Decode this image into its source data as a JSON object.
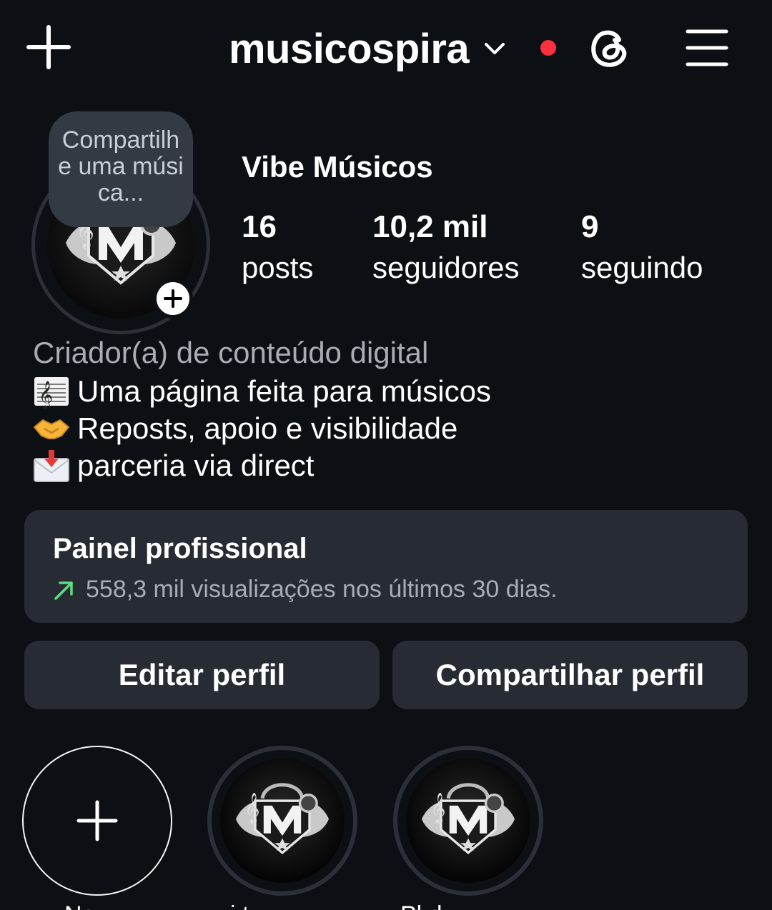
{
  "header": {
    "username": "musicospira",
    "icons": {
      "create": "plus-icon",
      "account_switch": "chevron-down-icon",
      "threads": "threads-icon",
      "menu": "hamburger-menu-icon"
    },
    "notification_dot_color": "#ff3040"
  },
  "profile": {
    "note": "Compartilhe uma música...",
    "display_name": "Vibe Músicos",
    "stats": {
      "posts": {
        "value": "16",
        "label": "posts"
      },
      "followers": {
        "value": "10,2 mil",
        "label": "seguidores"
      },
      "following": {
        "value": "9",
        "label": "seguindo"
      }
    },
    "category": "Criador(a) de conteúdo digital",
    "bio": [
      {
        "emoji": "musical-score-emoji",
        "text": "Uma página feita para músicos"
      },
      {
        "emoji": "handshake-emoji",
        "text": "Reposts, apoio e visibilidade"
      },
      {
        "emoji": "inbox-tray-emoji",
        "text": "parceria via direct"
      }
    ]
  },
  "dashboard": {
    "title": "Painel profissional",
    "subtitle": "558,3 mil visualizações nos últimos 30 dias.",
    "trend_color": "#5fdd82"
  },
  "actions": {
    "edit_label": "Editar perfil",
    "share_label": "Compartilhar perfil"
  },
  "highlights": [
    {
      "label": "No",
      "type": "new"
    },
    {
      "label": "i t",
      "type": "logo"
    },
    {
      "label": "Pl d",
      "type": "logo"
    }
  ],
  "colors": {
    "background": "#0c1014",
    "card": "#272b33",
    "muted_text": "#a8adb5"
  }
}
